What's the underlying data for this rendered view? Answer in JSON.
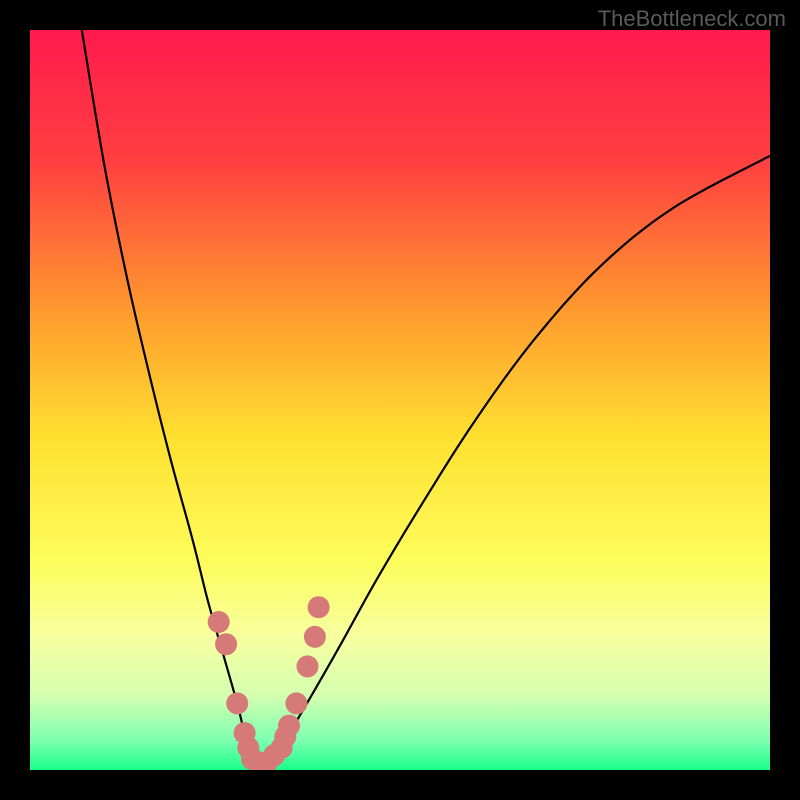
{
  "watermark": "TheBottleneck.com",
  "chart_data": {
    "type": "line",
    "title": "",
    "xlabel": "",
    "ylabel": "",
    "xlim": [
      0,
      100
    ],
    "ylim": [
      0,
      100
    ],
    "series": [
      {
        "name": "curve",
        "x": [
          7,
          10,
          13,
          16,
          19,
          22,
          24,
          26,
          28,
          29,
          30,
          31,
          32,
          33,
          35,
          38,
          42,
          47,
          53,
          60,
          68,
          77,
          87,
          100
        ],
        "y": [
          100,
          82,
          67,
          54,
          42,
          31,
          23,
          16,
          9,
          5,
          2.5,
          1,
          1,
          2.5,
          5,
          10,
          17,
          26,
          36,
          47,
          58,
          68,
          76,
          83
        ]
      }
    ],
    "highlight_points": {
      "name": "markers",
      "color": "#d67979",
      "x": [
        25.5,
        26.5,
        28,
        29,
        29.5,
        30,
        31,
        32,
        33,
        34,
        34.5,
        35,
        36,
        37.5,
        38.5,
        39
      ],
      "y": [
        20,
        17,
        9,
        5,
        3,
        1.5,
        1,
        1,
        2,
        3,
        4.5,
        6,
        9,
        14,
        18,
        22
      ]
    },
    "background_gradient": {
      "stops": [
        {
          "offset": 0,
          "color": "#ff1a4d"
        },
        {
          "offset": 0.18,
          "color": "#ff4040"
        },
        {
          "offset": 0.38,
          "color": "#ff9a2e"
        },
        {
          "offset": 0.55,
          "color": "#ffe030"
        },
        {
          "offset": 0.72,
          "color": "#fdfd5c"
        },
        {
          "offset": 0.82,
          "color": "#f7ffa0"
        },
        {
          "offset": 0.9,
          "color": "#d4ffb0"
        },
        {
          "offset": 0.96,
          "color": "#7dffb0"
        },
        {
          "offset": 1.0,
          "color": "#1aff8a"
        }
      ]
    }
  }
}
